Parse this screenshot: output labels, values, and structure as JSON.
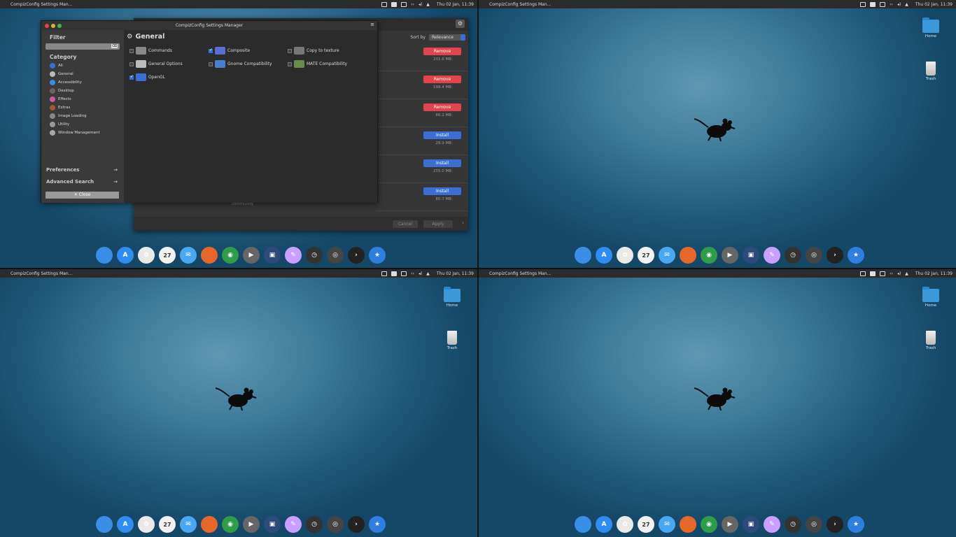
{
  "topbar": {
    "title": "CompizConfig Settings Man...",
    "clock": "Thu 02 Jan, 11:39"
  },
  "desktop": {
    "home_label": "Home",
    "trash_label": "Trash"
  },
  "ccsm": {
    "title": "CompizConfig Settings Manager",
    "filter_label": "Filter",
    "category_label": "Category",
    "categories": [
      "All",
      "General",
      "Accessibility",
      "Desktop",
      "Effects",
      "Extras",
      "Image Loading",
      "Utility",
      "Window Management"
    ],
    "preferences": "Preferences",
    "advanced_search": "Advanced Search",
    "close": "✕ Close",
    "section": "General",
    "plugins": [
      {
        "name": "Commands",
        "checked": false
      },
      {
        "name": "Composite",
        "checked": true
      },
      {
        "name": "Copy to texture",
        "checked": false
      },
      {
        "name": "General Options",
        "checked": false
      },
      {
        "name": "Gnome Compatibility",
        "checked": false
      },
      {
        "name": "MATE Compatibility",
        "checked": false
      },
      {
        "name": "OpenGL",
        "checked": true
      }
    ]
  },
  "software": {
    "sort_label": "Sort by",
    "sort_value": "Relevance",
    "rows": [
      {
        "action": "Remove",
        "size": "201.6 MB",
        "color": "#e0454d"
      },
      {
        "action": "Remove",
        "size": "199.4 MB",
        "color": "#e0454d"
      },
      {
        "action": "Remove",
        "size": "66.2 MB",
        "color": "#e0454d"
      },
      {
        "action": "Install",
        "size": "29.9 MB",
        "color": "#3b6fd6"
      },
      {
        "action": "Install",
        "size": "255.0 MB",
        "color": "#3b6fd6"
      },
      {
        "action": "Install",
        "size": "80.7 MB",
        "color": "#3b6fd6"
      }
    ],
    "community": "community",
    "cancel": "Cancel",
    "apply": "Apply"
  },
  "dock": [
    "finder-icon",
    "appstore-icon",
    "photos-icon",
    "calendar-icon",
    "mail-icon",
    "firefox-icon",
    "chrome-icon",
    "media-icon",
    "screenshot-icon",
    "editor-icon",
    "clock-icon",
    "disk-icon",
    "terminal-icon",
    "favorites-icon"
  ],
  "dock_calendar_day": "27"
}
